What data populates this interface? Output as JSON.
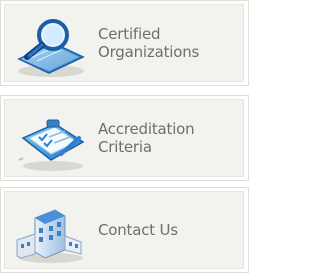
{
  "nav": {
    "items": [
      {
        "label_line1": "Certified",
        "label_line2": "Organizations",
        "icon": "magnifier-document-icon"
      },
      {
        "label_line1": "Accreditation",
        "label_line2": "Criteria",
        "icon": "clipboard-checklist-icon"
      },
      {
        "label_line1": "Contact Us",
        "label_line2": "",
        "icon": "office-building-icon"
      }
    ]
  },
  "colors": {
    "card_background": "#f2f2ee",
    "card_border": "#dfdfd8",
    "label_text": "#6f6f6a",
    "icon_blue": "#2f7fd0"
  }
}
